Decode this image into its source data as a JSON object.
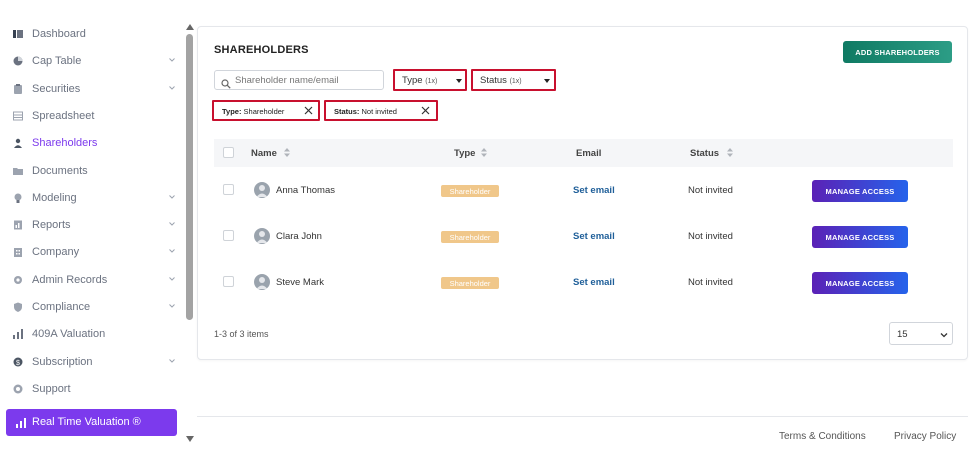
{
  "sidebar": {
    "items": [
      {
        "label": "Dashboard",
        "icon": "dashboard-icon",
        "chevron": false,
        "active": false
      },
      {
        "label": "Cap Table",
        "icon": "pie-chart-icon",
        "chevron": true,
        "active": false
      },
      {
        "label": "Securities",
        "icon": "clipboard-icon",
        "chevron": true,
        "active": false
      },
      {
        "label": "Spreadsheet",
        "icon": "spreadsheet-icon",
        "chevron": false,
        "active": false
      },
      {
        "label": "Shareholders",
        "icon": "user-icon",
        "chevron": false,
        "active": true
      },
      {
        "label": "Documents",
        "icon": "folder-icon",
        "chevron": false,
        "active": false
      },
      {
        "label": "Modeling",
        "icon": "lightbulb-icon",
        "chevron": true,
        "active": false
      },
      {
        "label": "Reports",
        "icon": "report-icon",
        "chevron": true,
        "active": false
      },
      {
        "label": "Company",
        "icon": "building-icon",
        "chevron": true,
        "active": false
      },
      {
        "label": "Admin Records",
        "icon": "admin-icon",
        "chevron": true,
        "active": false
      },
      {
        "label": "Compliance",
        "icon": "shield-icon",
        "chevron": true,
        "active": false
      },
      {
        "label": "409A Valuation",
        "icon": "valuation-icon",
        "chevron": false,
        "active": false
      },
      {
        "label": "Subscription",
        "icon": "dollar-icon",
        "chevron": true,
        "active": false
      },
      {
        "label": "Support",
        "icon": "support-icon",
        "chevron": false,
        "active": false
      }
    ],
    "cta_label": "Real Time Valuation ®"
  },
  "main": {
    "title": "SHAREHOLDERS",
    "add_button": "ADD SHAREHOLDERS",
    "search_placeholder": "Shareholder name/email",
    "filters": {
      "type_label": "Type",
      "type_count": "(1x)",
      "status_label": "Status",
      "status_count": "(1x)"
    },
    "chips": [
      {
        "key": "Type:",
        "value": "Shareholder"
      },
      {
        "key": "Status:",
        "value": "Not invited"
      }
    ],
    "columns": {
      "name": "Name",
      "type": "Type",
      "email": "Email",
      "status": "Status"
    },
    "rows": [
      {
        "name": "Anna Thomas",
        "type": "Shareholder",
        "email": "Set email",
        "status": "Not invited",
        "action": "MANAGE ACCESS"
      },
      {
        "name": "Clara John",
        "type": "Shareholder",
        "email": "Set email",
        "status": "Not invited",
        "action": "MANAGE ACCESS"
      },
      {
        "name": "Steve Mark",
        "type": "Shareholder",
        "email": "Set email",
        "status": "Not invited",
        "action": "MANAGE ACCESS"
      }
    ],
    "pagination": {
      "summary": "1-3 of 3 items",
      "page_size": "15"
    }
  },
  "footer": {
    "terms": "Terms & Conditions",
    "privacy": "Privacy Policy"
  },
  "colors": {
    "accent": "#7c3aed",
    "add_button": "#0f7a63",
    "filter_outline": "#c8102e",
    "badge": "#f0c78a",
    "link": "#1f5f99"
  }
}
